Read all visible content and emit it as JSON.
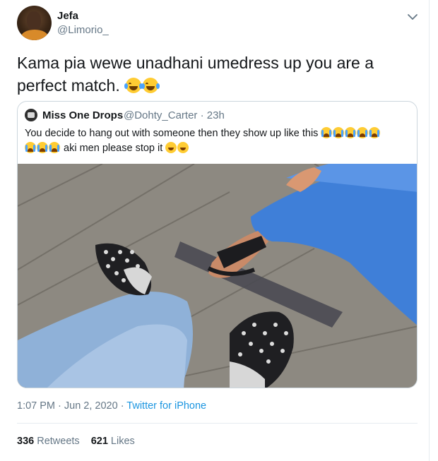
{
  "tweet": {
    "author_name": "Jefa",
    "author_handle": "@Limorio_",
    "text": "Kama pia wewe unadhani umedress up you are a perfect match.",
    "timestamp": "1:07 PM · Jun 2, 2020",
    "separator": " · ",
    "source": "Twitter for iPhone",
    "retweets_count": "336",
    "retweets_label": "Retweets",
    "likes_count": "621",
    "likes_label": "Likes"
  },
  "quoted": {
    "author_name": "Miss One Drops",
    "author_handle": "@Dohty_Carter · 23h",
    "text_line1": "You decide to hang out with someone then they show up like this",
    "text_line2": "aki men please stop it"
  },
  "icons": {
    "caret": "chevron-down-icon",
    "laugh": "face-with-tears-of-joy-emoji",
    "cry": "loudly-crying-face-emoji"
  },
  "colors": {
    "link": "#1b95e0",
    "muted": "#657786",
    "text": "#14171a",
    "border": "#ccd6dd"
  }
}
